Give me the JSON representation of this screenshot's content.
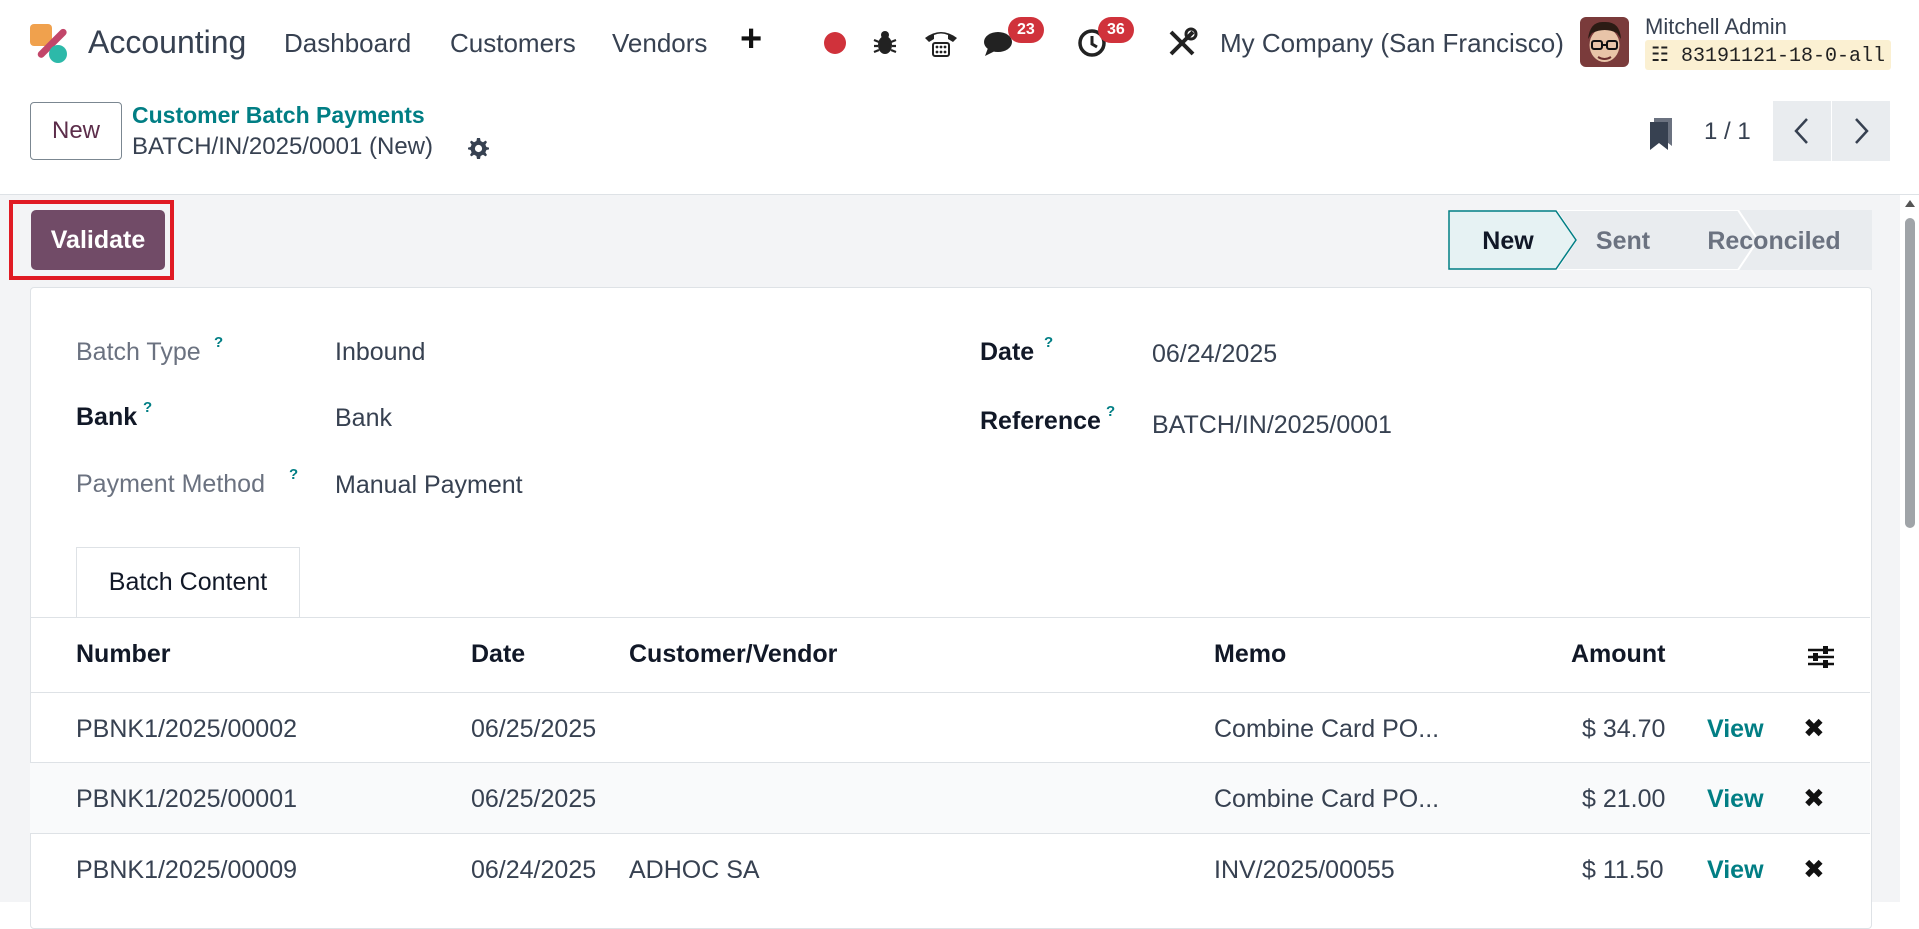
{
  "navbar": {
    "app_name": "Accounting",
    "menu": [
      "Dashboard",
      "Customers",
      "Vendors"
    ],
    "messages_badge": "23",
    "activities_badge": "36",
    "company": "My Company (San Francisco)",
    "user_name": "Mitchell Admin",
    "database": "83191121-18-0-all"
  },
  "control_panel": {
    "new_label": "New",
    "breadcrumb_parent": "Customer Batch Payments",
    "breadcrumb_current": "BATCH/IN/2025/0001 (New)",
    "pager": "1 / 1"
  },
  "statusbar": {
    "validate_label": "Validate",
    "stages": [
      "New",
      "Sent",
      "Reconciled"
    ],
    "active_stage": "New",
    "colors": {
      "validate": "#714b67",
      "active_stage": "#e6f2f3",
      "inactive_stage": "#e9ecef"
    }
  },
  "form": {
    "batch_type_label": "Batch Type",
    "batch_type": "Inbound",
    "bank_label": "Bank",
    "bank": "Bank",
    "payment_method_label": "Payment Method",
    "payment_method": "Manual Payment",
    "date_label": "Date",
    "date": "06/24/2025",
    "reference_label": "Reference",
    "reference": "BATCH/IN/2025/0001",
    "help_marker": "?"
  },
  "tabs": [
    "Batch Content"
  ],
  "table": {
    "headers": {
      "number": "Number",
      "date": "Date",
      "partner": "Customer/Vendor",
      "memo": "Memo",
      "amount": "Amount"
    },
    "rows": [
      {
        "number": "PBNK1/2025/00002",
        "date": "06/25/2025",
        "partner": "",
        "memo": "Combine Card PO...",
        "amount": "$ 34.70",
        "action": "View"
      },
      {
        "number": "PBNK1/2025/00001",
        "date": "06/25/2025",
        "partner": "",
        "memo": "Combine Card PO...",
        "amount": "$ 21.00",
        "action": "View"
      },
      {
        "number": "PBNK1/2025/00009",
        "date": "06/24/2025",
        "partner": "ADHOC SA",
        "memo": "INV/2025/00055",
        "amount": "$ 11.50",
        "action": "View"
      }
    ]
  },
  "icons": {
    "logo": "odoo-accounting-logo",
    "plus": "plus-icon",
    "record": "record-icon",
    "bug": "bug-icon",
    "phone": "phone-icon",
    "chat": "chat-icon",
    "clock": "clock-icon",
    "tools": "tools-icon",
    "gear": "gear-icon",
    "bookmark": "bookmark-icon",
    "settings_columns": "sliders-icon",
    "delete": "close-icon"
  }
}
